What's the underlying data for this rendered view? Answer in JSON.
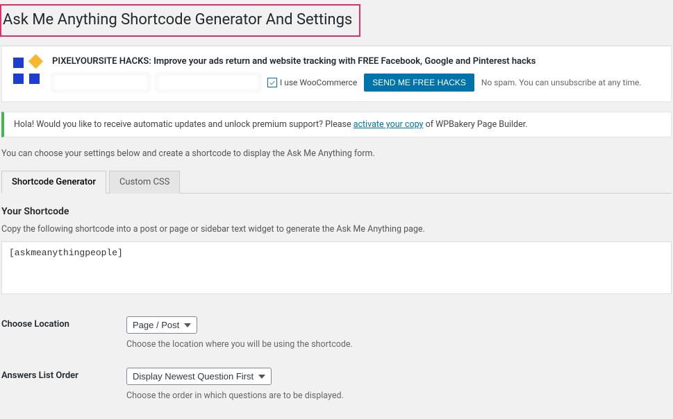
{
  "header": {
    "title": "Ask Me Anything Shortcode Generator And Settings"
  },
  "promo": {
    "headline": "PIXELYOURSITE HACKS: Improve your ads return and website tracking with FREE Facebook, Google and Pinterest hacks",
    "checkbox_label": "I use WooCommerce",
    "send_label": "SEND ME FREE HACKS",
    "nospam": "No spam. You can unsubscribe at any time."
  },
  "notice": {
    "prefix": "Hola! Would you like to receive automatic updates and unlock premium support? Please ",
    "link": "activate your copy",
    "suffix": " of WPBakery Page Builder."
  },
  "intro": "You can choose your settings below and create a shortcode to display the Ask Me Anything form.",
  "tabs": {
    "generator": "Shortcode Generator",
    "custom_css": "Custom CSS"
  },
  "shortcode_section": {
    "title": "Your Shortcode",
    "desc": "Copy the following shortcode into a post or page or sidebar text widget to generate the Ask Me Anything page.",
    "value": "[askmeanythingpeople]"
  },
  "fields": {
    "location": {
      "label": "Choose Location",
      "value": "Page / Post",
      "desc": "Choose the location where you will be using the shortcode."
    },
    "order": {
      "label": "Answers List Order",
      "value": "Display Newest Question First",
      "desc": "Choose the order in which questions are to be displayed."
    }
  }
}
